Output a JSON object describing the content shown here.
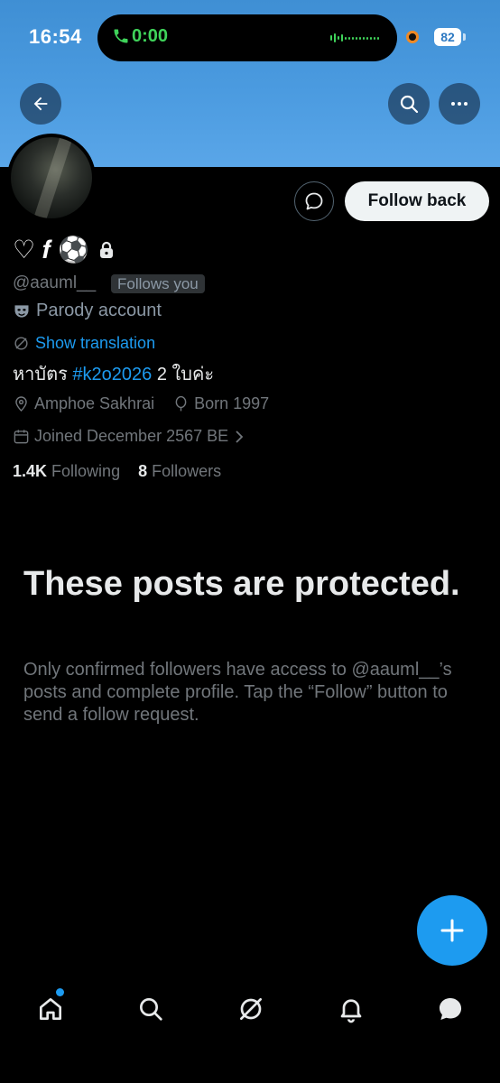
{
  "status_bar": {
    "time": "16:54",
    "call_timer": "0:00",
    "battery": "82"
  },
  "icons": {
    "back": "arrow-left-icon",
    "search": "search-icon",
    "more": "more-icon",
    "message": "message-icon",
    "lock": "lock-icon",
    "parody": "mask-icon",
    "translate": "translate-icon",
    "location": "location-pin-icon",
    "birthday": "balloon-icon",
    "calendar": "calendar-icon",
    "compose": "plus-icon"
  },
  "profile": {
    "display_name": "♡ 𝒇 ⚽",
    "handle": "@aauml__",
    "follows_you": "Follows you",
    "parody_label": "Parody account",
    "show_translation": "Show translation",
    "bio_before": "หาบัตร ",
    "bio_tag": "#k2o2026",
    "bio_after": " 2 ใบค่ะ",
    "location": "Amphoe Sakhrai",
    "born": "Born 1997",
    "joined": "Joined December 2567 BE",
    "following_count": "1.4K",
    "following_label": "Following",
    "followers_count": "8",
    "followers_label": "Followers"
  },
  "actions": {
    "follow_back": "Follow back"
  },
  "protected": {
    "title": "These posts are protected.",
    "body": "Only confirmed followers have access to @aauml__’s posts and complete profile. Tap the “Follow” button to send a follow request."
  },
  "tabs": [
    "home",
    "search",
    "grok",
    "notifications",
    "messages"
  ],
  "colors": {
    "accent": "#1d9bf0",
    "banner": "#4b9be0",
    "background": "#000000"
  }
}
